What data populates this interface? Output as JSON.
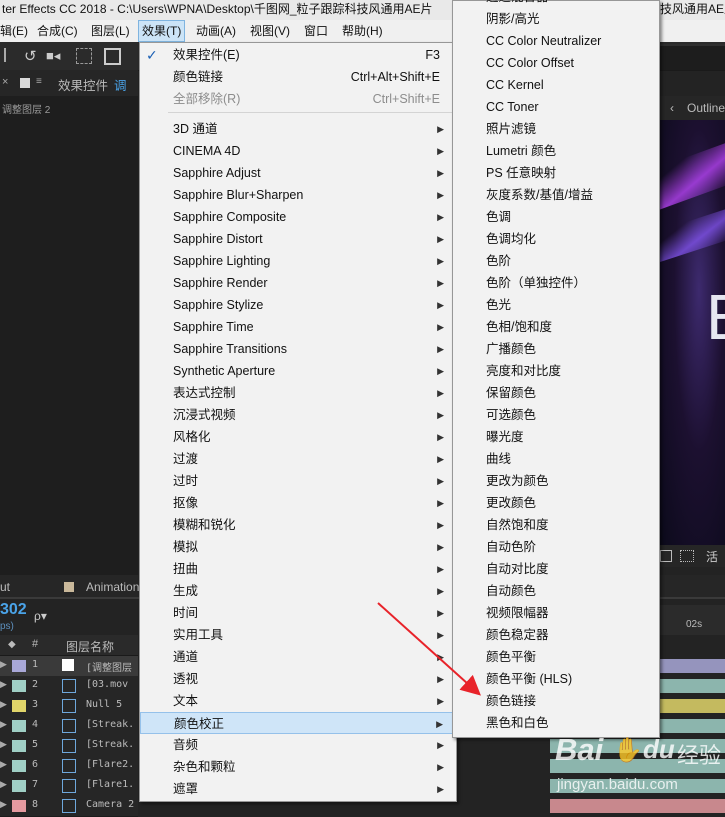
{
  "titlebar": {
    "text": "ter Effects CC 2018 - C:\\Users\\WPNA\\Desktop\\千图网_粒子跟踪科技风通用AE片",
    "text_right": "技风通用AE片"
  },
  "menubar": {
    "items": [
      "辑(E)",
      "合成(C)",
      "图层(L)",
      "效果(T)",
      "动画(A)",
      "视图(V)",
      "窗口",
      "帮助(H)"
    ]
  },
  "left_panel": {
    "tab_label": "效果控件",
    "tab_sub": "调整",
    "layer_label": "调整图层 2",
    "timeline_tab": "ut",
    "timeline_tab2": "Animation",
    "timecode": "302",
    "fps": "ps)",
    "search_placeholder": "ρ▾",
    "col_num": "#",
    "col_name": "图层名称"
  },
  "viewer": {
    "outline_label": "Outline",
    "big_glyph": "E",
    "bottom_label": "活",
    "ruler_label": "02s"
  },
  "layers": [
    {
      "num": "1",
      "name": "[调整图层",
      "color": "#a9a8d8"
    },
    {
      "num": "2",
      "name": "[03.mov",
      "color": "#9fcfc5"
    },
    {
      "num": "3",
      "name": "Null 5",
      "color": "#e1d56a"
    },
    {
      "num": "4",
      "name": "[Streak.",
      "color": "#9fcfc5"
    },
    {
      "num": "5",
      "name": "[Streak.",
      "color": "#9fcfc5"
    },
    {
      "num": "6",
      "name": "[Flare2.",
      "color": "#9fcfc5"
    },
    {
      "num": "7",
      "name": "[Flare1.",
      "color": "#9fcfc5"
    },
    {
      "num": "8",
      "name": "Camera 2",
      "color": "#e59aa0"
    }
  ],
  "effects_menu": {
    "items": [
      {
        "label": "效果控件(E)",
        "shortcut": "F3",
        "checked": true
      },
      {
        "label": "颜色链接",
        "shortcut": "Ctrl+Alt+Shift+E"
      },
      {
        "label": "全部移除(R)",
        "shortcut": "Ctrl+Shift+E",
        "disabled": true
      },
      {
        "label": "3D 通道",
        "arrow": true
      },
      {
        "label": "CINEMA 4D",
        "arrow": true
      },
      {
        "label": "Sapphire Adjust",
        "arrow": true
      },
      {
        "label": "Sapphire Blur+Sharpen",
        "arrow": true
      },
      {
        "label": "Sapphire Composite",
        "arrow": true
      },
      {
        "label": "Sapphire Distort",
        "arrow": true
      },
      {
        "label": "Sapphire Lighting",
        "arrow": true
      },
      {
        "label": "Sapphire Render",
        "arrow": true
      },
      {
        "label": "Sapphire Stylize",
        "arrow": true
      },
      {
        "label": "Sapphire Time",
        "arrow": true
      },
      {
        "label": "Sapphire Transitions",
        "arrow": true
      },
      {
        "label": "Synthetic Aperture",
        "arrow": true
      },
      {
        "label": "表达式控制",
        "arrow": true
      },
      {
        "label": "沉浸式视频",
        "arrow": true
      },
      {
        "label": "风格化",
        "arrow": true
      },
      {
        "label": "过渡",
        "arrow": true
      },
      {
        "label": "过时",
        "arrow": true
      },
      {
        "label": "抠像",
        "arrow": true
      },
      {
        "label": "模糊和锐化",
        "arrow": true
      },
      {
        "label": "模拟",
        "arrow": true
      },
      {
        "label": "扭曲",
        "arrow": true
      },
      {
        "label": "生成",
        "arrow": true
      },
      {
        "label": "时间",
        "arrow": true
      },
      {
        "label": "实用工具",
        "arrow": true
      },
      {
        "label": "通道",
        "arrow": true
      },
      {
        "label": "透视",
        "arrow": true
      },
      {
        "label": "文本",
        "arrow": true
      },
      {
        "label": "颜色校正",
        "arrow": true,
        "highlighted": true
      },
      {
        "label": "音频",
        "arrow": true
      },
      {
        "label": "杂色和颗粒",
        "arrow": true
      },
      {
        "label": "遮罩",
        "arrow": true
      }
    ]
  },
  "color_correction_menu": {
    "top_partial": "通道混合器",
    "items": [
      "阴影/高光",
      "CC Color Neutralizer",
      "CC Color Offset",
      "CC Kernel",
      "CC Toner",
      "照片滤镜",
      "Lumetri 颜色",
      "PS 任意映射",
      "灰度系数/基值/增益",
      "色调",
      "色调均化",
      "色阶",
      "色阶（单独控件）",
      "色光",
      "色相/饱和度",
      "广播颜色",
      "亮度和对比度",
      "保留颜色",
      "可选颜色",
      "曝光度",
      "曲线",
      "更改为颜色",
      "更改颜色",
      "自然饱和度",
      "自动色阶",
      "自动对比度",
      "自动颜色",
      "视频限幅器",
      "颜色稳定器",
      "颜色平衡",
      "颜色平衡 (HLS)",
      "颜色链接",
      "黑色和白色"
    ]
  },
  "watermark": {
    "brand": "Bai",
    "brand_mid": "du",
    "brand_suffix": "经验",
    "url": "jingyan.baidu.com"
  },
  "annotation": {
    "arrow_color": "#e8232a"
  }
}
